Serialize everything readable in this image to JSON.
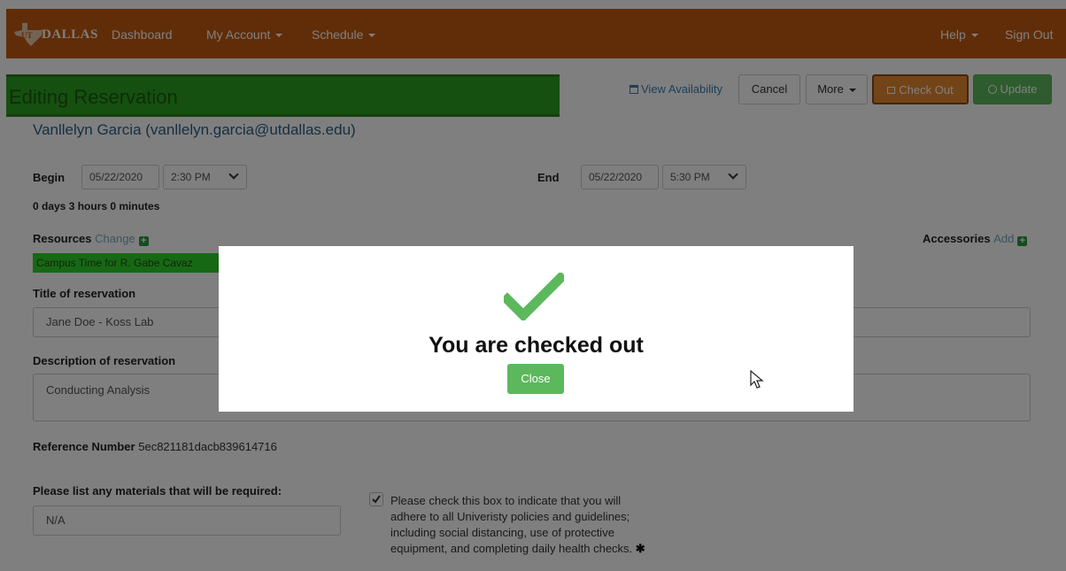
{
  "nav": {
    "logo_text": "DALLAS",
    "logo_mark": "UT",
    "dashboard": "Dashboard",
    "my_account": "My Account",
    "schedule": "Schedule",
    "help": "Help",
    "sign_out": "Sign Out"
  },
  "header": {
    "title": "Editing Reservation",
    "owner": "Vanllelyn Garcia (vanllelyn.garcia@utdallas.edu)",
    "view_availability": "View Availability",
    "cancel": "Cancel",
    "more": "More",
    "check_out": "Check Out",
    "update": "Update"
  },
  "form": {
    "begin_label": "Begin",
    "begin_date": "05/22/2020",
    "begin_time": "2:30 PM",
    "end_label": "End",
    "end_date": "05/22/2020",
    "end_time": "5:30 PM",
    "duration": "0 days 3 hours 0 minutes",
    "resources_label": "Resources",
    "resources_change": "Change",
    "resource_item": "Campus Time for R. Gabe Cavaz",
    "accessories_label": "Accessories",
    "accessories_add": "Add",
    "title_label": "Title of reservation",
    "title_value": "Jane Doe - Koss Lab",
    "description_label": "Description of reservation",
    "description_value": "Conducting Analysis",
    "reference_label": "Reference Number",
    "reference_value": "5ec821181dacb839614716",
    "materials_label": "Please list any materials that will be required:",
    "materials_value": "N/A",
    "policy_line1": "Please check this box to indicate that you will",
    "policy_line2": "adhere to all Univeristy policies and guidelines;",
    "policy_line3": "including social distancing, use of protective",
    "policy_line4": "equipment, and completing daily health checks.",
    "required_mark": "✱"
  },
  "modal": {
    "message": "You are checked out",
    "close": "Close"
  },
  "colors": {
    "navbar": "#c05a10",
    "title_bar": "#2aa121",
    "success": "#5cb85c",
    "check_out": "#e6892e"
  }
}
